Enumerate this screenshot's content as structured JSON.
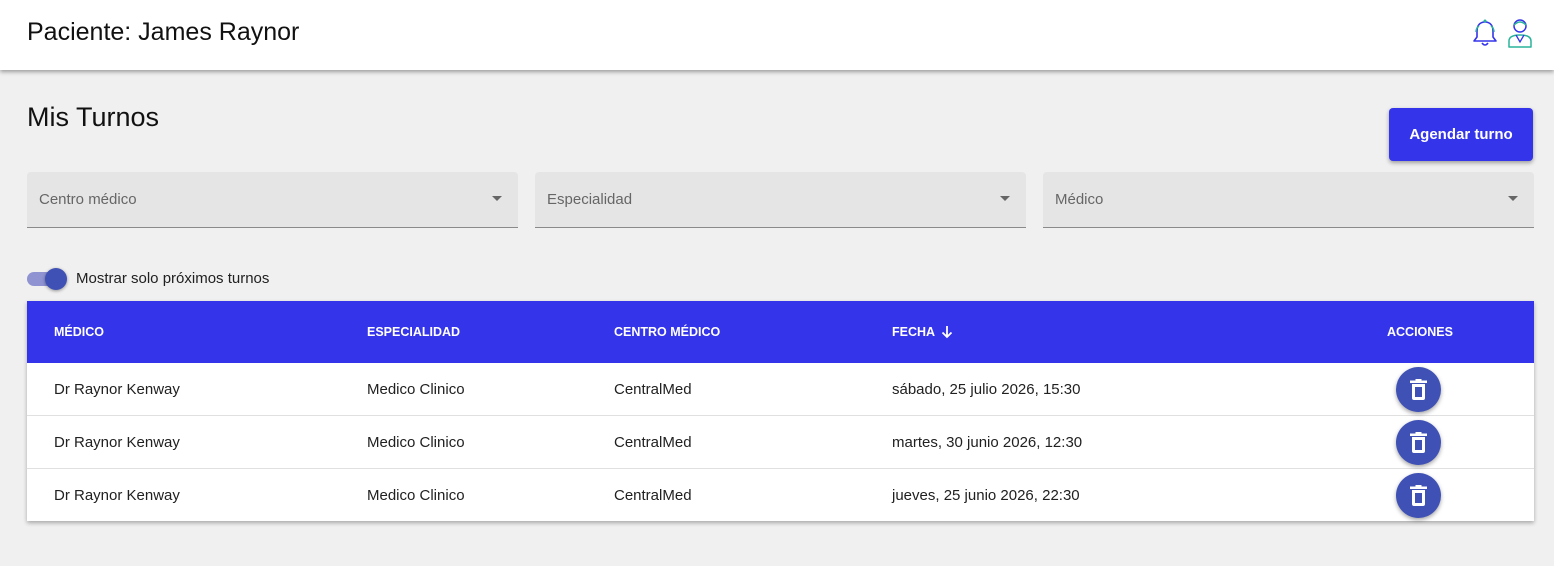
{
  "header": {
    "title": "Paciente: James Raynor",
    "icons": [
      "bell-icon",
      "doctor-avatar-icon"
    ]
  },
  "page": {
    "title": "Mis Turnos",
    "cta_label": "Agendar turno"
  },
  "filters": [
    {
      "label": "Centro médico"
    },
    {
      "label": "Especialidad"
    },
    {
      "label": "Médico"
    }
  ],
  "toggle": {
    "label": "Mostrar solo próximos turnos",
    "on": true
  },
  "table": {
    "columns": [
      "MÉDICO",
      "ESPECIALIDAD",
      "CENTRO MÉDICO",
      "FECHA",
      "ACCIONES"
    ],
    "sort_column": "FECHA",
    "sort_direction": "desc",
    "rows": [
      {
        "medico": "Dr Raynor Kenway",
        "especialidad": "Medico Clinico",
        "centro": "CentralMed",
        "fecha": "sábado, 25 julio 2026, 15:30"
      },
      {
        "medico": "Dr Raynor Kenway",
        "especialidad": "Medico Clinico",
        "centro": "CentralMed",
        "fecha": "martes, 30 junio 2026, 12:30"
      },
      {
        "medico": "Dr Raynor Kenway",
        "especialidad": "Medico Clinico",
        "centro": "CentralMed",
        "fecha": "jueves, 25 junio 2026, 22:30"
      }
    ]
  },
  "colors": {
    "primary": "#3434ea",
    "accent": "#3f51b5",
    "background": "#f0f0f0"
  }
}
